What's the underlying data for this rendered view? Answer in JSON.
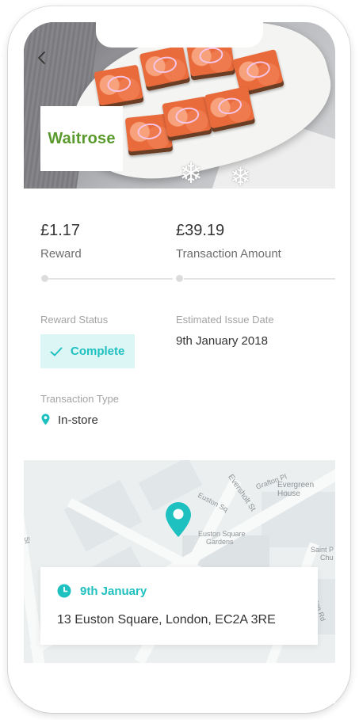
{
  "merchant": {
    "name": "Waitrose"
  },
  "stats": {
    "reward_amount": "£1.17",
    "reward_label": "Reward",
    "transaction_amount": "£39.19",
    "transaction_label": "Transaction Amount"
  },
  "details": {
    "reward_status_label": "Reward Status",
    "reward_status_value": "Complete",
    "issue_date_label": "Estimated Issue Date",
    "issue_date_value": "9th January 2018",
    "transaction_type_label": "Transaction Type",
    "transaction_type_value": "In-store"
  },
  "map": {
    "labels": [
      "Grafton Pl",
      "Evergreen House",
      "Eversholt St",
      "Euston Sq",
      "Euston Square",
      "Gardens",
      "Saint P",
      "Chu",
      "Euston Rd",
      "St"
    ],
    "card": {
      "date": "9th January",
      "address": "13 Euston Square, London, EC2A 3RE"
    }
  },
  "colors": {
    "accent": "#1ec1bf",
    "status_bg": "#dcf5f5",
    "brand_green": "#5a9a2c"
  },
  "icons": [
    "back-chevron-icon",
    "check-icon",
    "location-pin-icon",
    "map-pin-icon",
    "clock-icon"
  ]
}
